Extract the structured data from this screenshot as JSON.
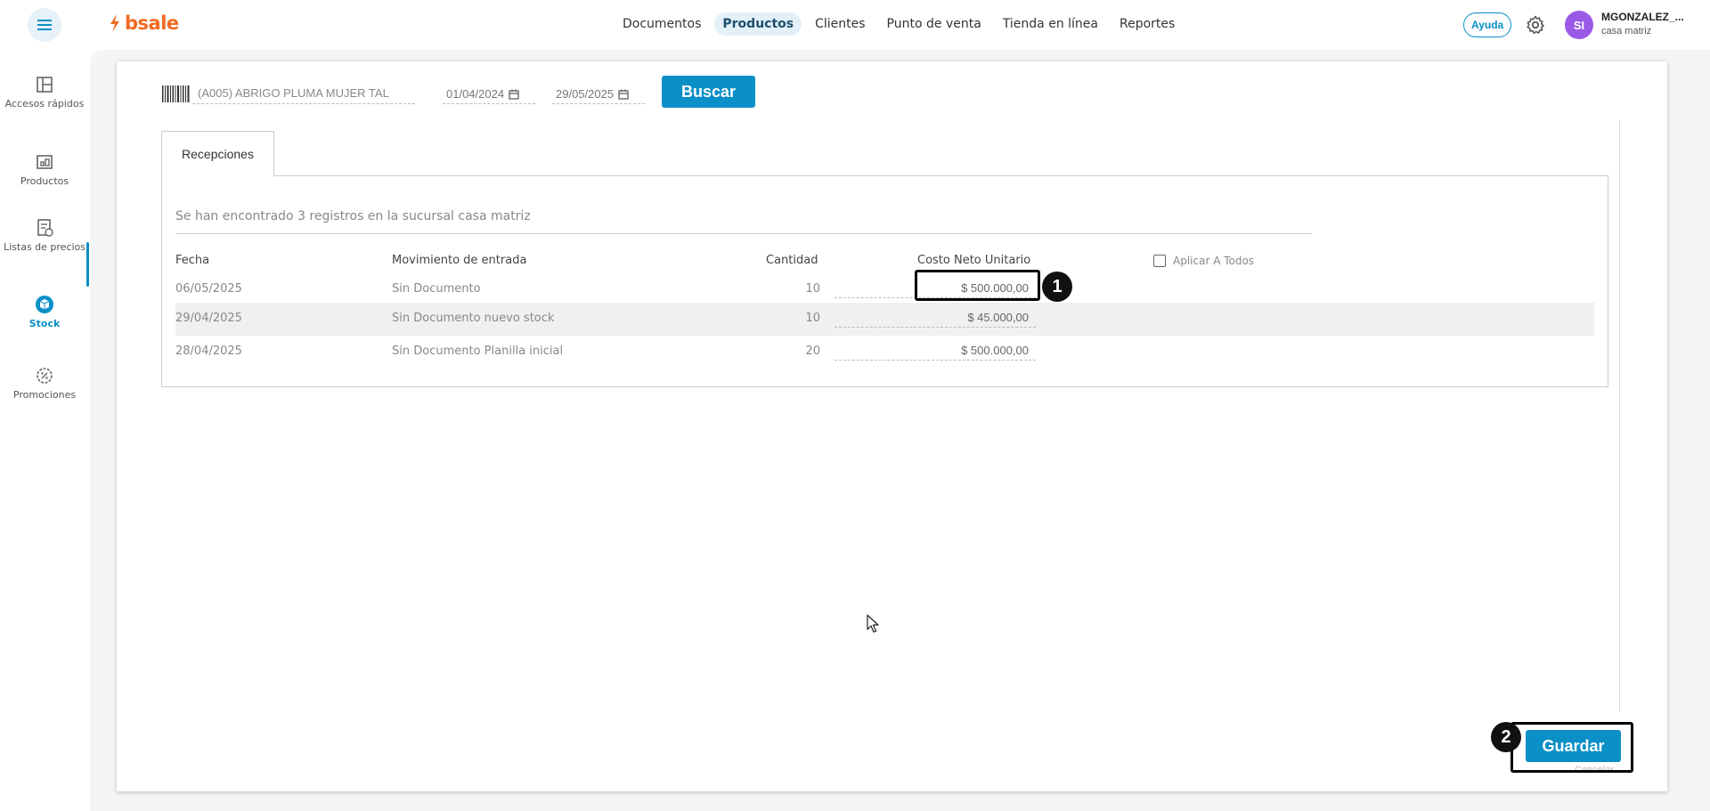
{
  "brand": {
    "name": "bsale",
    "color": "#f26a21"
  },
  "nav": {
    "items": [
      {
        "label": "Documentos",
        "active": false
      },
      {
        "label": "Productos",
        "active": true
      },
      {
        "label": "Clientes",
        "active": false
      },
      {
        "label": "Punto de venta",
        "active": false
      },
      {
        "label": "Tienda en línea",
        "active": false
      },
      {
        "label": "Reportes",
        "active": false
      }
    ]
  },
  "header": {
    "help_label": "Ayuda",
    "avatar_initials": "SI",
    "user_name": "MGONZALEZ_...",
    "branch": "casa matriz"
  },
  "sidebar": {
    "items": [
      {
        "label": "Accesos rápidos",
        "icon": "quick-access-icon",
        "active": false
      },
      {
        "label": "Productos",
        "icon": "products-icon",
        "active": false
      },
      {
        "label": "Listas de precios",
        "icon": "price-list-icon",
        "active": false
      },
      {
        "label": "Stock",
        "icon": "stock-box-icon",
        "active": true
      },
      {
        "label": "Promociones",
        "icon": "promotions-icon",
        "active": false
      }
    ]
  },
  "filters": {
    "product": "(A005) ABRIGO PLUMA MUJER TAL",
    "date_from": "01/04/2024",
    "date_to": "29/05/2025",
    "search_label": "Buscar"
  },
  "tabs": [
    {
      "label": "Recepciones",
      "active": true
    }
  ],
  "results": {
    "message": "Se han encontrado 3 registros en la sucursal casa matriz",
    "columns": {
      "date": "Fecha",
      "movement": "Movimiento de entrada",
      "quantity": "Cantidad",
      "unit_cost": "Costo Neto Unitario"
    },
    "apply_all_label": "Aplicar A Todos",
    "rows": [
      {
        "date": "06/05/2025",
        "movement": "Sin Documento",
        "quantity": "10",
        "cost": "$ 500.000,00"
      },
      {
        "date": "29/04/2025",
        "movement": "Sin Documento nuevo stock",
        "quantity": "10",
        "cost": "$ 45.000,00"
      },
      {
        "date": "28/04/2025",
        "movement": "Sin Documento Planilla inicial",
        "quantity": "20",
        "cost": "$ 500.000,00"
      }
    ]
  },
  "actions": {
    "save_label": "Guardar",
    "cancel_label": "Cancelar"
  },
  "annotations": {
    "marker_1": "1",
    "marker_2": "2"
  },
  "colors": {
    "accent": "#0a8fc7",
    "avatar": "#9b59e8"
  }
}
